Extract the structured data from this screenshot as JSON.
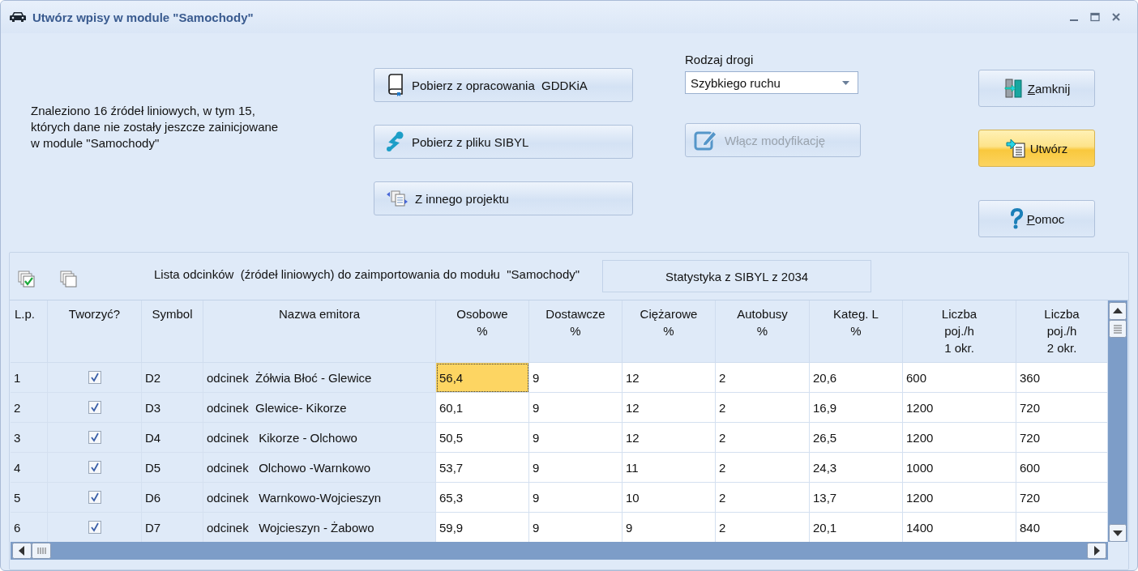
{
  "window": {
    "title": "Utwórz wpisy w module \"Samochody\""
  },
  "info_text": "Znaleziono 16 źródeł liniowych, w tym 15,\nktórych dane nie zostały jeszcze zainicjowane\nw module \"Samochody\"",
  "import_buttons": [
    {
      "kind": "book",
      "label": "Pobierz z opracowania  GDDKiA"
    },
    {
      "kind": "sibyl",
      "label": "Pobierz z pliku SIBYL"
    },
    {
      "kind": "project",
      "label": "Z innego projektu"
    }
  ],
  "road_type": {
    "label": "Rodzaj drogi",
    "value": "Szybkiego ruchu"
  },
  "modify_button": {
    "label": "Włącz modyfikację",
    "disabled": true
  },
  "action_buttons": [
    {
      "kind": "close",
      "label": "Zamknij",
      "underline_first": true,
      "highlighted": false
    },
    {
      "kind": "create",
      "label": "Utwórz",
      "underline_first": false,
      "highlighted": true
    },
    {
      "kind": "help",
      "label": "Pomoc",
      "underline_first": true,
      "highlighted": false
    }
  ],
  "list_title": "Lista odcinków  (źródeł liniowych) do zaimportowania do modułu  \"Samochody\"",
  "statistics_label": "Statystyka z SIBYL z 2034",
  "table": {
    "columns": [
      "L.p.",
      "Tworzyć?",
      "Symbol",
      "Nazwa emitora",
      "Osobowe\n%",
      "Dostawcze\n%",
      "Ciężarowe\n%",
      "Autobusy\n%",
      "Kateg. L\n%",
      "Liczba\npoj./h\n1 okr.",
      "Liczba\npoj./h\n2 okr."
    ],
    "rows": [
      {
        "lp": "1",
        "checked": true,
        "symbol": "D2",
        "name": "odcinek  Żółwia Błoć - Glewice",
        "values": [
          {
            "text": "56,4",
            "selected": true
          },
          {
            "text": "9",
            "selected": false
          },
          {
            "text": "12",
            "selected": false
          },
          {
            "text": "2",
            "selected": false
          },
          {
            "text": "20,6",
            "selected": false
          },
          {
            "text": "600",
            "selected": false
          },
          {
            "text": "360",
            "selected": false
          }
        ]
      },
      {
        "lp": "2",
        "checked": true,
        "symbol": "D3",
        "name": "odcinek  Glewice- Kikorze",
        "values": [
          {
            "text": "60,1",
            "selected": false
          },
          {
            "text": "9",
            "selected": false
          },
          {
            "text": "12",
            "selected": false
          },
          {
            "text": "2",
            "selected": false
          },
          {
            "text": "16,9",
            "selected": false
          },
          {
            "text": "1200",
            "selected": false
          },
          {
            "text": "720",
            "selected": false
          }
        ]
      },
      {
        "lp": "3",
        "checked": true,
        "symbol": "D4",
        "name": "odcinek   Kikorze - Olchowo",
        "values": [
          {
            "text": "50,5",
            "selected": false
          },
          {
            "text": "9",
            "selected": false
          },
          {
            "text": "12",
            "selected": false
          },
          {
            "text": "2",
            "selected": false
          },
          {
            "text": "26,5",
            "selected": false
          },
          {
            "text": "1200",
            "selected": false
          },
          {
            "text": "720",
            "selected": false
          }
        ]
      },
      {
        "lp": "4",
        "checked": true,
        "symbol": "D5",
        "name": "odcinek   Olchowo -Warnkowo",
        "values": [
          {
            "text": "53,7",
            "selected": false
          },
          {
            "text": "9",
            "selected": false
          },
          {
            "text": "11",
            "selected": false
          },
          {
            "text": "2",
            "selected": false
          },
          {
            "text": "24,3",
            "selected": false
          },
          {
            "text": "1000",
            "selected": false
          },
          {
            "text": "600",
            "selected": false
          }
        ]
      },
      {
        "lp": "5",
        "checked": true,
        "symbol": "D6",
        "name": "odcinek   Warnkowo-Wojcieszyn",
        "values": [
          {
            "text": "65,3",
            "selected": false
          },
          {
            "text": "9",
            "selected": false
          },
          {
            "text": "10",
            "selected": false
          },
          {
            "text": "2",
            "selected": false
          },
          {
            "text": "13,7",
            "selected": false
          },
          {
            "text": "1200",
            "selected": false
          },
          {
            "text": "720",
            "selected": false
          }
        ]
      },
      {
        "lp": "6",
        "checked": true,
        "symbol": "D7",
        "name": "odcinek   Wojcieszyn - Żabowo",
        "values": [
          {
            "text": "59,9",
            "selected": false
          },
          {
            "text": "9",
            "selected": false
          },
          {
            "text": "9",
            "selected": false
          },
          {
            "text": "2",
            "selected": false
          },
          {
            "text": "20,1",
            "selected": false
          },
          {
            "text": "1400",
            "selected": false
          },
          {
            "text": "840",
            "selected": false
          }
        ]
      }
    ]
  }
}
